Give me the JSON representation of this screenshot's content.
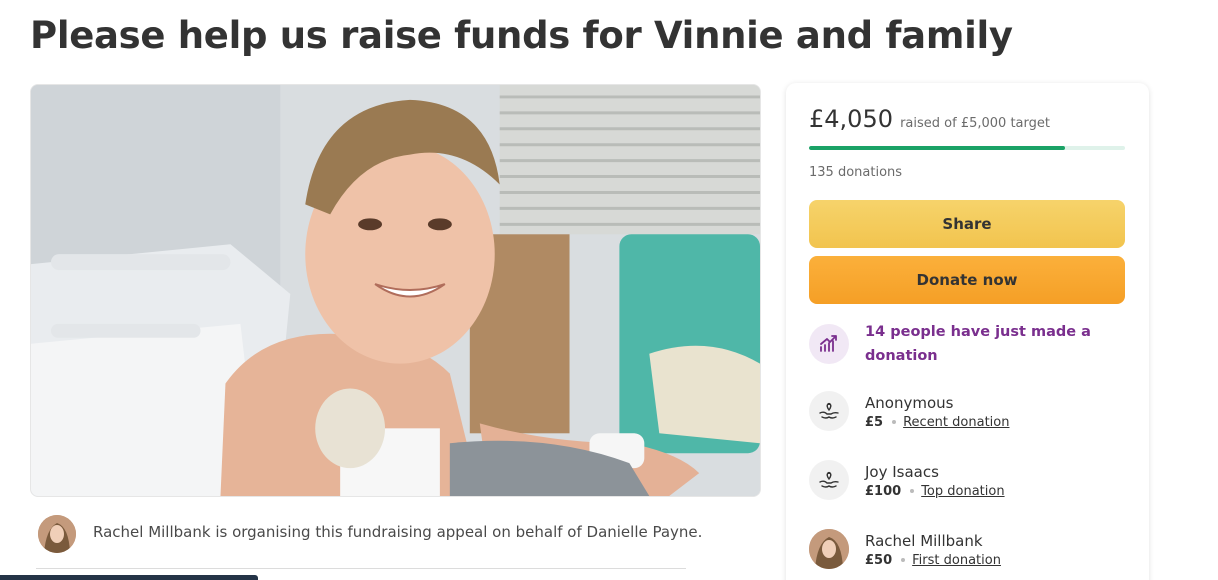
{
  "page": {
    "title": "Please help us raise funds for Vinnie and family"
  },
  "organiser": {
    "text": "Rachel Millbank is organising this fundraising appeal on behalf of Danielle Payne."
  },
  "donation_card": {
    "raised_amount": "£4,050",
    "raised_caption": "raised of £5,000 target",
    "progress_fraction": 0.81,
    "donation_count": "135 donations",
    "share_label": "Share",
    "donate_label": "Donate now",
    "trending": "14 people have just made a donation",
    "donors": [
      {
        "name": "Anonymous",
        "amount": "£5",
        "tag": "Recent donation",
        "icon": "hands-heart-icon"
      },
      {
        "name": "Joy Isaacs",
        "amount": "£100",
        "tag": "Top donation",
        "icon": "hands-heart-icon"
      },
      {
        "name": "Rachel Millbank",
        "amount": "£50",
        "tag": "First donation",
        "icon": "avatar"
      }
    ]
  },
  "colors": {
    "progress": "#1aa266",
    "share_button": "#f2c44e",
    "donate_button": "#f59f26",
    "trending_text": "#7a2f8e"
  }
}
